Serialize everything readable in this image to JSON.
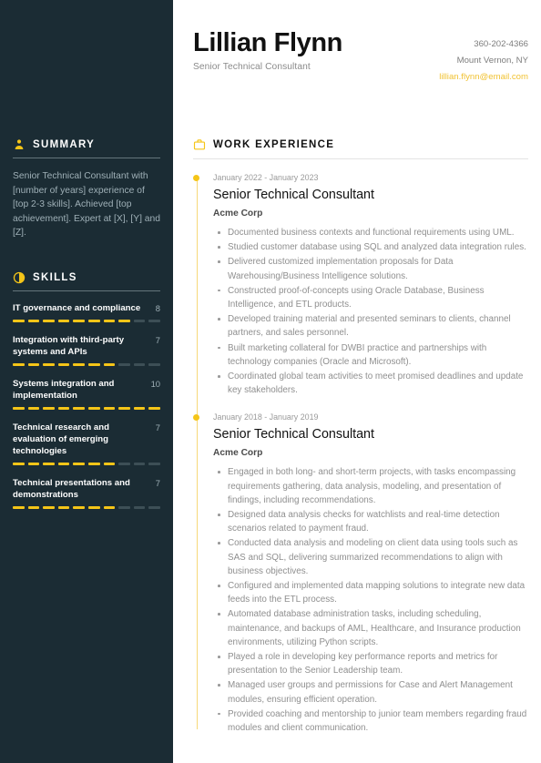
{
  "theme": {
    "sidebar_bg": "#1b2c34",
    "accent": "#f5c518",
    "accent_email": "#f1c232",
    "text_dark": "#111111",
    "text_muted": "#8f8f8f"
  },
  "header": {
    "name": "Lillian Flynn",
    "role": "Senior Technical Consultant",
    "contact": {
      "phone": "360-202-4366",
      "location": "Mount Vernon, NY",
      "email": "lillian.flynn@email.com"
    }
  },
  "sidebar": {
    "summary": {
      "icon": "person-icon",
      "title": "SUMMARY",
      "text": "Senior Technical Consultant with [number of years] experience of [top 2-3 skills]. Achieved [top achievement]. Expert at [X], [Y] and [Z]."
    },
    "skills": {
      "icon": "pie-chart-icon",
      "title": "SKILLS",
      "max": 10,
      "items": [
        {
          "name": "IT governance and compliance",
          "score": 8
        },
        {
          "name": "Integration with third-party systems and APIs",
          "score": 7
        },
        {
          "name": "Systems integration and implementation",
          "score": 10
        },
        {
          "name": "Technical research and evaluation of emerging technologies",
          "score": 7
        },
        {
          "name": "Technical presentations and demonstrations",
          "score": 7
        }
      ]
    }
  },
  "main": {
    "work_experience": {
      "icon": "briefcase-icon",
      "title": "WORK EXPERIENCE",
      "jobs": [
        {
          "dates": "January 2022 - January 2023",
          "title": "Senior Technical Consultant",
          "company": "Acme Corp",
          "bullets": [
            "Documented business contexts and functional requirements using UML.",
            "Studied customer database using SQL and analyzed data integration rules.",
            "Delivered customized implementation proposals for Data Warehousing/Business Intelligence solutions.",
            "Constructed proof-of-concepts using Oracle Database, Business Intelligence, and ETL products.",
            "Developed training material and presented seminars to clients, channel partners, and sales personnel.",
            "Built marketing collateral for DWBI practice and partnerships with technology companies (Oracle and Microsoft).",
            "Coordinated global team activities to meet promised deadlines and update key stakeholders."
          ]
        },
        {
          "dates": "January 2018 - January 2019",
          "title": "Senior Technical Consultant",
          "company": "Acme Corp",
          "bullets": [
            "Engaged in both long- and short-term projects, with tasks encompassing requirements gathering, data analysis, modeling, and presentation of findings, including recommendations.",
            "Designed data analysis checks for watchlists and real-time detection scenarios related to payment fraud.",
            "Conducted data analysis and modeling on client data using tools such as SAS and SQL, delivering summarized recommendations to align with business objectives.",
            "Configured and implemented data mapping solutions to integrate new data feeds into the ETL process.",
            "Automated database administration tasks, including scheduling, maintenance, and backups of AML, Healthcare, and Insurance production environments, utilizing Python scripts.",
            "Played a role in developing key performance reports and metrics for presentation to the Senior Leadership team.",
            "Managed user groups and permissions for Case and Alert Management modules, ensuring efficient operation.",
            "Provided coaching and mentorship to junior team members regarding fraud modules and client communication."
          ]
        }
      ]
    }
  }
}
